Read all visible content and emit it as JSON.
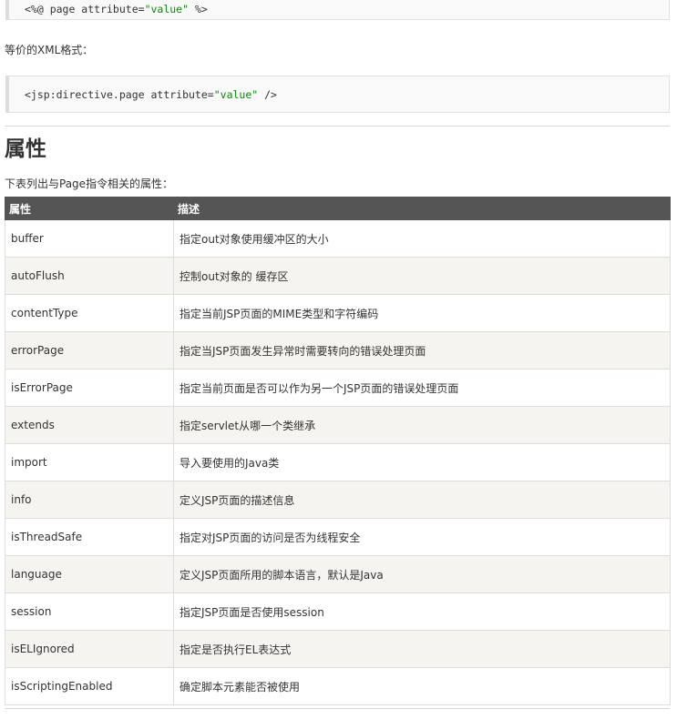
{
  "code_top": {
    "prefix": "<%@ page attribute=",
    "value": "\"value\"",
    "suffix": " %>"
  },
  "intro_xml": "等价的XML格式：",
  "code_xml": {
    "prefix": "<jsp:directive.page attribute=",
    "value": "\"value\"",
    "suffix": " />"
  },
  "section": {
    "title": "属性",
    "description": "下表列出与Page指令相关的属性："
  },
  "table": {
    "headers": [
      "属性",
      "描述"
    ],
    "rows": [
      [
        "buffer",
        "指定out对象使用缓冲区的大小"
      ],
      [
        "autoFlush",
        "控制out对象的 缓存区"
      ],
      [
        "contentType",
        "指定当前JSP页面的MIME类型和字符编码"
      ],
      [
        "errorPage",
        "指定当JSP页面发生异常时需要转向的错误处理页面"
      ],
      [
        "isErrorPage",
        "指定当前页面是否可以作为另一个JSP页面的错误处理页面"
      ],
      [
        "extends",
        "指定servlet从哪一个类继承"
      ],
      [
        "import",
        "导入要使用的Java类"
      ],
      [
        "info",
        "定义JSP页面的描述信息"
      ],
      [
        "isThreadSafe",
        "指定对JSP页面的访问是否为线程安全"
      ],
      [
        "language",
        "定义JSP页面所用的脚本语言，默认是Java"
      ],
      [
        "session",
        "指定JSP页面是否使用session"
      ],
      [
        "isELIgnored",
        "指定是否执行EL表达式"
      ],
      [
        "isScriptingEnabled",
        "确定脚本元素能否被使用"
      ]
    ]
  }
}
